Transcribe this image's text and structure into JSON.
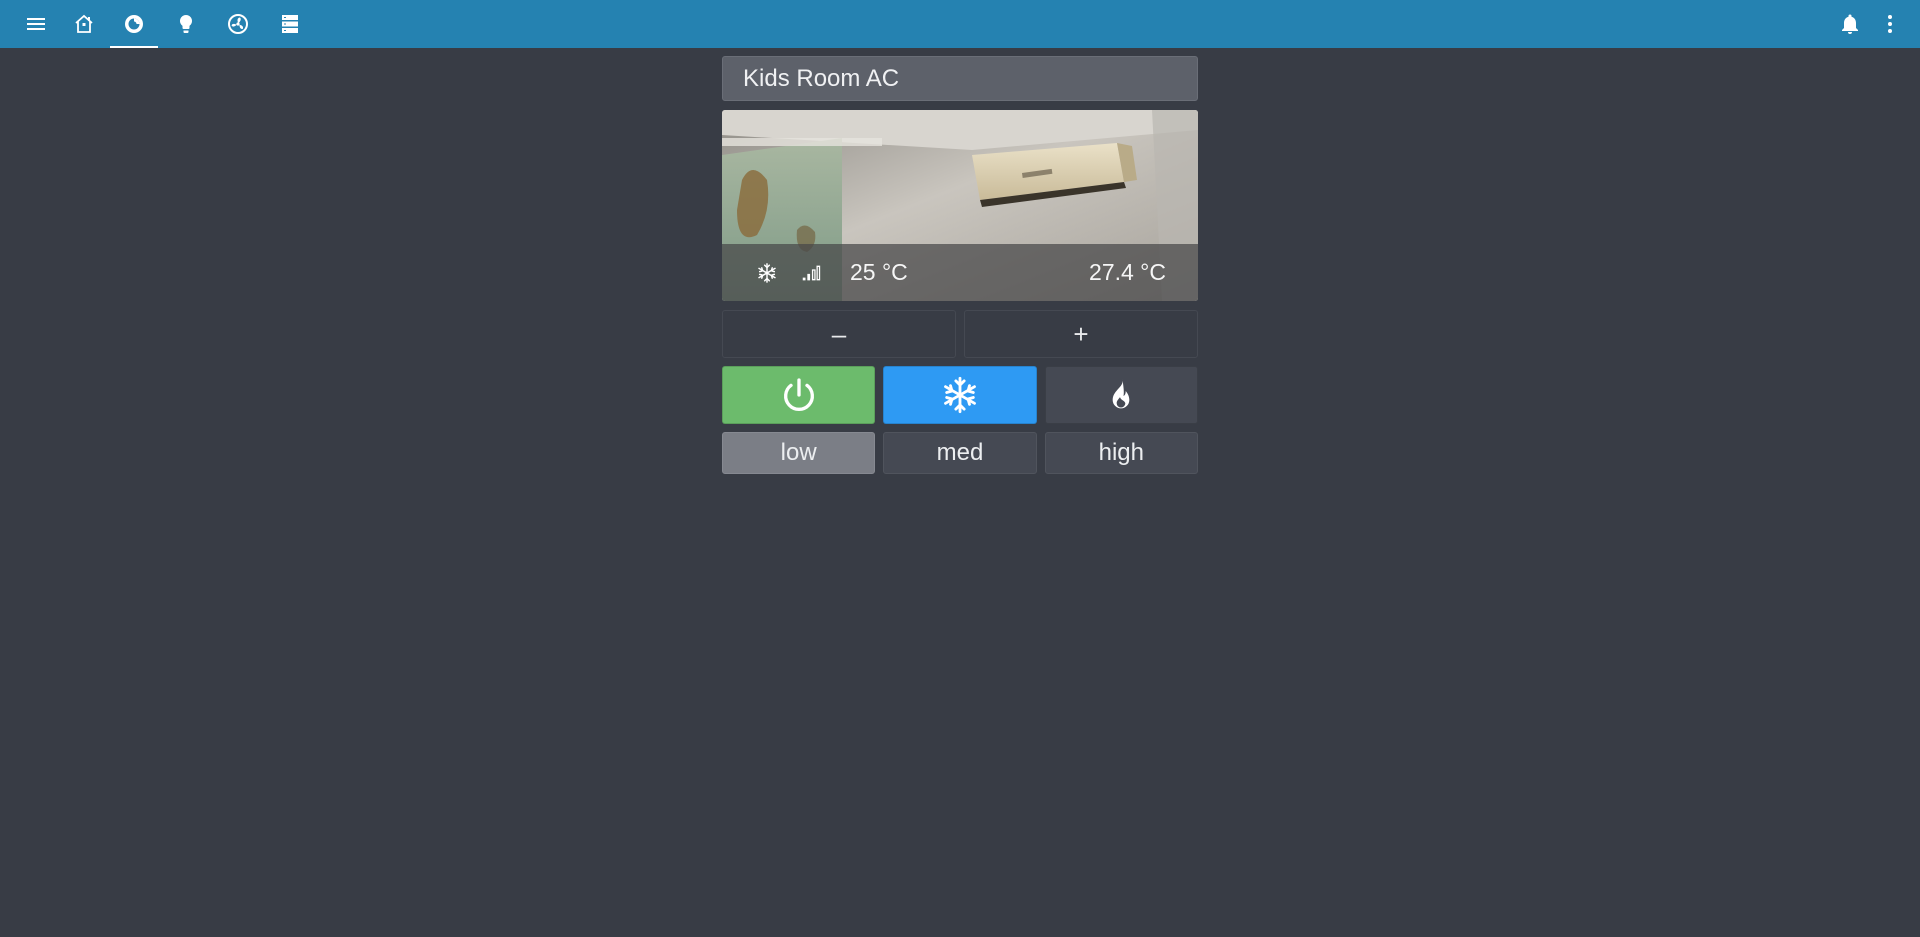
{
  "topbar": {
    "background": "#2582b1",
    "icons": [
      "menu-icon",
      "home-icon",
      "thermostat-view-icon",
      "lightbulb-icon",
      "fan-icon",
      "server-icon",
      "bell-icon",
      "more-vert-icon"
    ],
    "active_tab": "thermostat-view-icon"
  },
  "card": {
    "title": "Kids Room AC",
    "overlay": {
      "mode_icon": "snowflake-icon",
      "fan_icon": "signal-bars-icon",
      "target_temp": "25 °C",
      "current_temp": "27.4 °C"
    },
    "adjust": {
      "decrease_label": "–",
      "increase_label": "+"
    },
    "modes": [
      {
        "name": "off",
        "icon": "power-icon",
        "color": "#6cbb6c"
      },
      {
        "name": "cool",
        "icon": "snowflake-icon",
        "color": "#2e9af3",
        "active": true
      },
      {
        "name": "heat",
        "icon": "fire-icon",
        "color": "#454953"
      }
    ],
    "fan_modes": [
      {
        "label": "low",
        "selected": true
      },
      {
        "label": "med",
        "selected": false
      },
      {
        "label": "high",
        "selected": false
      }
    ]
  }
}
